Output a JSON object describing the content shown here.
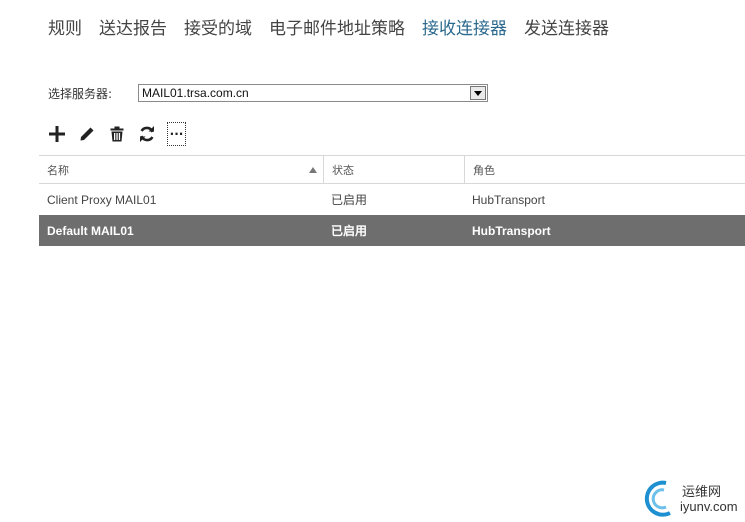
{
  "tabs": [
    {
      "label": "规则"
    },
    {
      "label": "送达报告"
    },
    {
      "label": "接受的域"
    },
    {
      "label": "电子邮件地址策略"
    },
    {
      "label": "接收连接器"
    },
    {
      "label": "发送连接器"
    }
  ],
  "active_tab": "接收连接器",
  "server": {
    "label": "选择服务器:",
    "value": "MAIL01.trsa.com.cn"
  },
  "toolbar": {
    "more_label": "···"
  },
  "table": {
    "headers": [
      "名称",
      "状态",
      "角色"
    ],
    "rows": [
      [
        "Client Proxy MAIL01",
        "已启用",
        "HubTransport"
      ],
      [
        "Default MAIL01",
        "已启用",
        "HubTransport"
      ]
    ],
    "selected_row": 1
  },
  "watermark": {
    "cn": "运维网",
    "en": "iyunv.com"
  },
  "colors": {
    "active_tab": "#2b6a8e",
    "selected_row": "#6e6e6e"
  }
}
